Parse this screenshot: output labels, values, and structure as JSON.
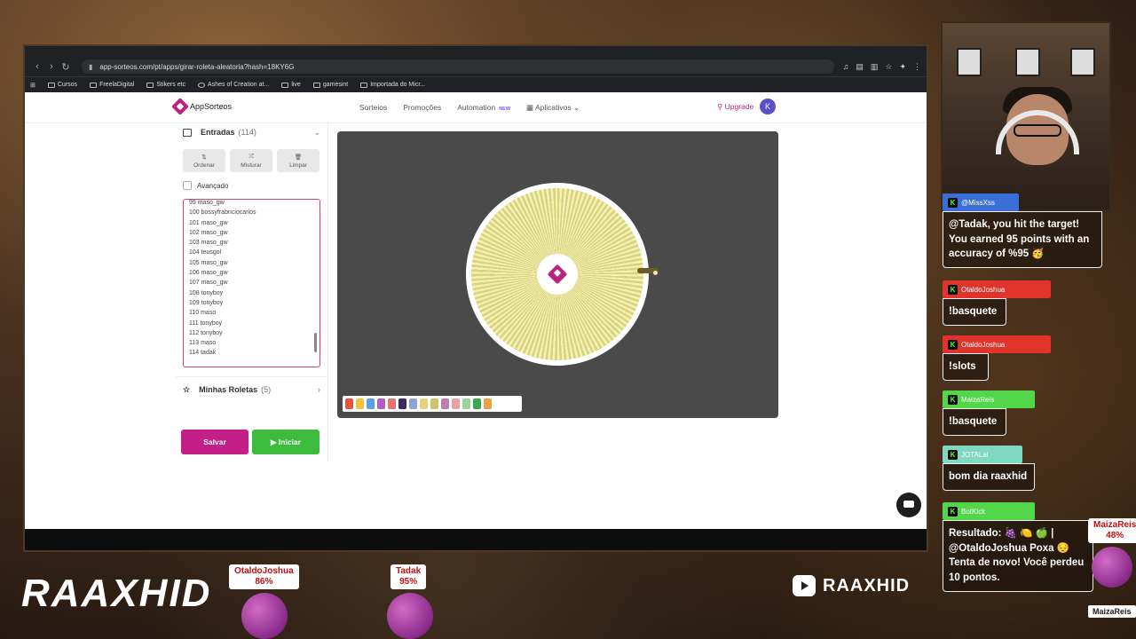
{
  "browser": {
    "url": "app-sorteos.com/pt/apps/girar-roleta-aleatoria?hash=18KY6G",
    "bookmarks": [
      "Cursos",
      "FreelaDigital",
      "Stikers etc",
      "Ashes of Creation at...",
      "live",
      "gamesint",
      "Importada do Micr..."
    ]
  },
  "app": {
    "logo": "AppSorteos",
    "nav": [
      "Sorteios",
      "Promoções",
      "Automation",
      "Aplicativos"
    ],
    "nav_badge": "NEW",
    "upgrade": "Upgrade",
    "avatar": "K"
  },
  "sidebar": {
    "entries_label": "Entradas",
    "entries_count": "(114)",
    "tools": [
      "Ordenar",
      "Misturar",
      "Limpar"
    ],
    "advanced": "Avançado",
    "entries": [
      "99 maso_gw",
      "100 bossyfrabriciocarios",
      "101 maso_gw",
      "102 maso_gw",
      "103 maso_gw",
      "104 teusgol",
      "105 maso_gw",
      "106 maso_gw",
      "107 maso_gw",
      "108 tonyboy",
      "109  tonyboy",
      "110 maso",
      "111 tonyboy",
      "112 tonyboy",
      "113 maso",
      "114 tadak"
    ],
    "my_wheels_label": "Minhas Roletas",
    "my_wheels_count": "(5)",
    "save": "Salvar",
    "start": "▶ Iniciar"
  },
  "palette_colors": [
    "#e8533b",
    "#f6c241",
    "#5aa0e6",
    "#b35cc9",
    "#e87070",
    "#3b2a6b",
    "#8ea4d8",
    "#e6d27a",
    "#d0c36a",
    "#c07bb0",
    "#f0a0a0",
    "#9bd39b",
    "#3da84a",
    "#f0a040"
  ],
  "chat": [
    {
      "user": "@MissXss",
      "color": "#3a6fd8",
      "text": "@Tadak, you hit the target! You earned 95 points with an accuracy of %95 🥳"
    },
    {
      "user": "OtaldoJoshua",
      "color": "#e0342a",
      "text": "!basquete"
    },
    {
      "user": "OtaldoJoshua",
      "color": "#e0342a",
      "text": "!slots"
    },
    {
      "user": "MaizaReis",
      "color": "#53d74a",
      "text": "!basquete"
    },
    {
      "user": "JOTALal",
      "color": "#7fd9c0",
      "text": "bom dia raaxhid"
    },
    {
      "user": "BotKick",
      "color": "#53d74a",
      "text": "Resultado: 🍇 🍋 🍏 | @OtaldoJoshua Poxa 😔 Tenta de novo! Você perdeu 10 pontos."
    }
  ],
  "overlay": {
    "brand": "RAAXHID",
    "youtube": "RAAXHID",
    "scores": [
      {
        "name": "OtaldoJoshua",
        "pct": "86%"
      },
      {
        "name": "Tadak",
        "pct": "95%"
      },
      {
        "name": "MaizaReis",
        "pct": "48%"
      }
    ],
    "maiza_tag": "MaizaReis"
  }
}
